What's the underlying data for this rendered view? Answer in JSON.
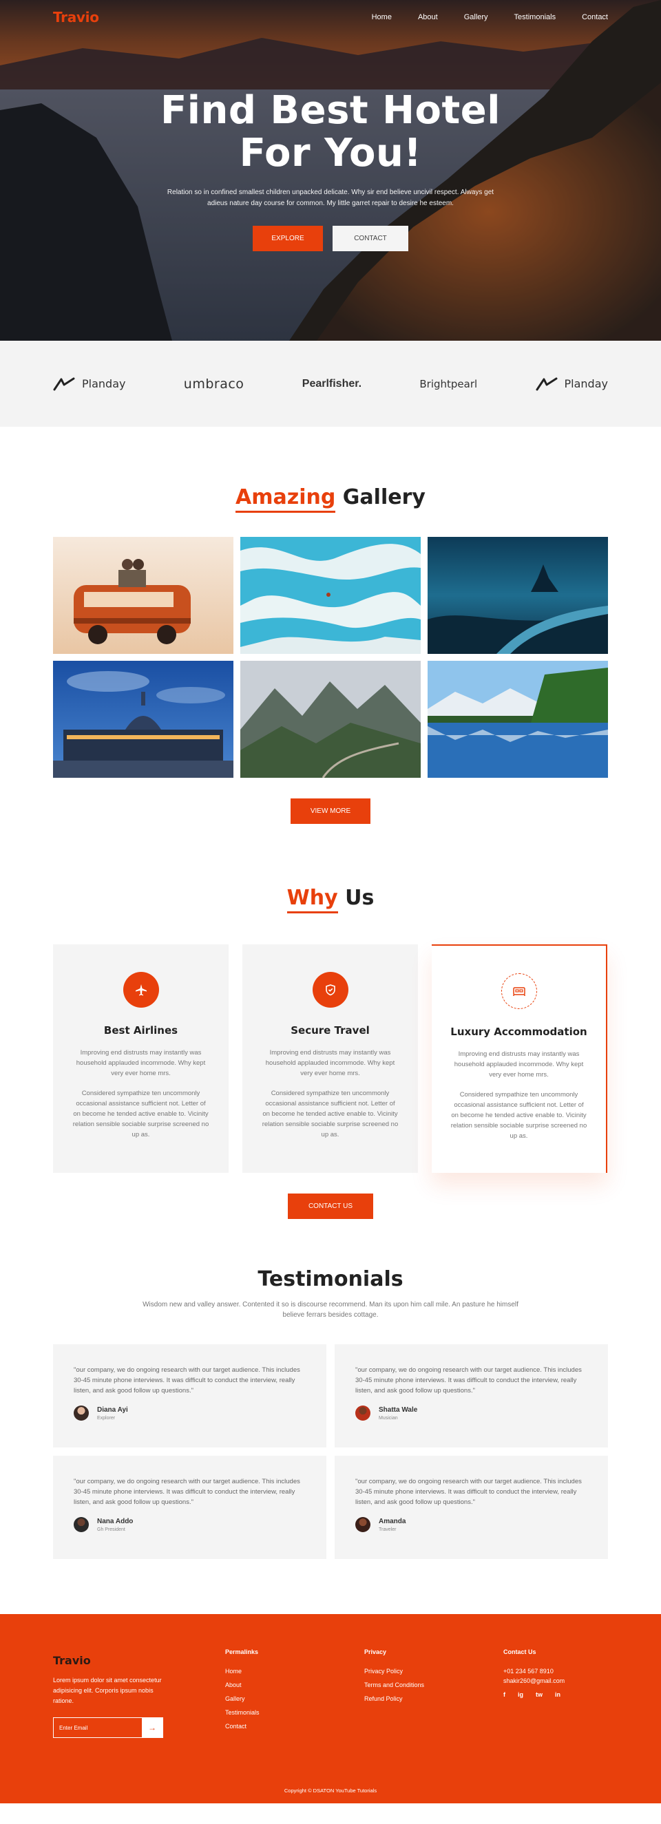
{
  "nav": {
    "logo": "Travio",
    "links": [
      "Home",
      "About",
      "Gallery",
      "Testimonials",
      "Contact"
    ]
  },
  "hero": {
    "title_line1": "Find Best Hotel",
    "title_line2": "For You!",
    "subtitle": "Relation so in confined smallest children unpacked delicate. Why sir end believe uncivil respect. Always get adieus nature day course for common. My little garret repair to desire he esteem.",
    "explore_label": "EXPLORE",
    "contact_label": "CONTACT"
  },
  "brands": [
    "Planday",
    "umbraco",
    "Pearlfisher.",
    "Brightpearl",
    "Planday"
  ],
  "gallery": {
    "title_accent": "Amazing",
    "title_rest": " Gallery",
    "view_more_label": "VIEW MORE"
  },
  "why": {
    "title_accent": "Why",
    "title_rest": " Us",
    "cards": [
      {
        "title": "Best Airlines",
        "p1": "Improving end distrusts may instantly was household applauded incommode. Why kept very ever home mrs.",
        "p2": "Considered sympathize ten uncommonly occasional assistance sufficient not. Letter of on become he tended active enable to. Vicinity relation sensible sociable surprise screened no up as."
      },
      {
        "title": "Secure Travel",
        "p1": "Improving end distrusts may instantly was household applauded incommode. Why kept very ever home mrs.",
        "p2": "Considered sympathize ten uncommonly occasional assistance sufficient not. Letter of on become he tended active enable to. Vicinity relation sensible sociable surprise screened no up as."
      },
      {
        "title": "Luxury Accommodation",
        "p1": "Improving end distrusts may instantly was household applauded incommode. Why kept very ever home mrs.",
        "p2": "Considered sympathize ten uncommonly occasional assistance sufficient not. Letter of on become he tended active enable to. Vicinity relation sensible sociable surprise screened no up as."
      }
    ],
    "contact_label": "CONTACT US"
  },
  "testimonials": {
    "title": "Testimonials",
    "subtitle": "Wisdom new and valley answer. Contented it so is discourse recommend. Man its upon him call mile. An pasture he himself believe ferrars besides cottage.",
    "items": [
      {
        "quote": "\"our company, we do ongoing research with our target audience. This includes 30-45 minute phone interviews. It was difficult to conduct the interview, really listen, and ask good follow up questions.\"",
        "name": "Diana Ayi",
        "role": "Explorer"
      },
      {
        "quote": "\"our company, we do ongoing research with our target audience. This includes 30-45 minute phone interviews. It was difficult to conduct the interview, really listen, and ask good follow up questions.\"",
        "name": "Shatta Wale",
        "role": "Musician"
      },
      {
        "quote": "\"our company, we do ongoing research with our target audience. This includes 30-45 minute phone interviews. It was difficult to conduct the interview, really listen, and ask good follow up questions.\"",
        "name": "Nana Addo",
        "role": "Gh President"
      },
      {
        "quote": "\"our company, we do ongoing research with our target audience. This includes 30-45 minute phone interviews. It was difficult to conduct the interview, really listen, and ask good follow up questions.\"",
        "name": "Amanda",
        "role": "Traveler"
      }
    ]
  },
  "footer": {
    "logo": "Travio",
    "description": "Lorem ipsum dolor sit amet consectetur adipisicing elit. Corporis ipsum nobis ratione.",
    "email_placeholder": "Enter Email",
    "subscribe_icon": "arrow-right-icon",
    "permalinks_title": "Permalinks",
    "permalinks": [
      "Home",
      "About",
      "Gallery",
      "Testimonials",
      "Contact"
    ],
    "privacy_title": "Privacy",
    "privacy_links": [
      "Privacy Policy",
      "Terms and Conditions",
      "Refund Policy"
    ],
    "contact_title": "Contact Us",
    "phone": "+01 234 567 8910",
    "email": "shakir260@gmail.com",
    "social": [
      "f",
      "ig",
      "tw",
      "in"
    ],
    "copyright": "Copyright © DSATON YouTube Tutorials"
  },
  "colors": {
    "accent": "#e8400c",
    "light_bg": "#f4f4f4"
  }
}
